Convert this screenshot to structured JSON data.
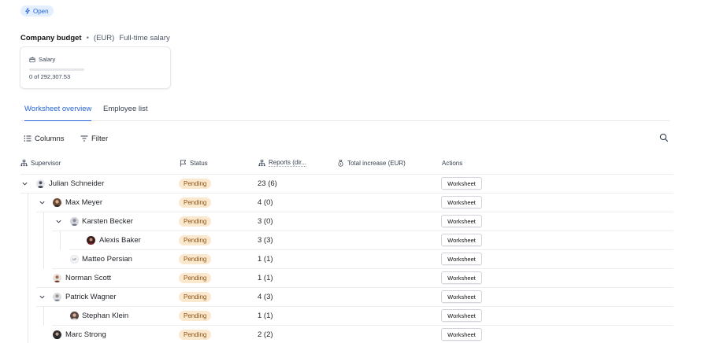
{
  "status_badge": {
    "label": "Open",
    "icon": "lightning-icon"
  },
  "budget": {
    "title": "Company budget",
    "separator": "•",
    "currency": "(EUR)",
    "type": "Full-time salary"
  },
  "salary_card": {
    "label": "Salary",
    "icon": "wallet-icon",
    "amount": "0 of 292,307.53",
    "progress": 0
  },
  "tabs": [
    {
      "label": "Worksheet overview",
      "active": true
    },
    {
      "label": "Employee list",
      "active": false
    }
  ],
  "toolbar": {
    "columns_label": "Columns",
    "filter_label": "Filter",
    "search_icon": "search-icon"
  },
  "columns": [
    {
      "label": "Supervisor",
      "icon": "hierarchy-icon"
    },
    {
      "label": "Status",
      "icon": "flag-icon"
    },
    {
      "label": "Reports (dir...",
      "icon": "hierarchy-icon"
    },
    {
      "label": "Total increase (EUR)",
      "icon": "money-bag-icon"
    },
    {
      "label": "Actions"
    }
  ],
  "rows": [
    {
      "name": "Julian Schneider",
      "status": "Pending",
      "reports": "23 (6)",
      "action": "Worksheet",
      "expanded": true
    },
    {
      "name": "Max Meyer",
      "status": "Pending",
      "reports": "4 (0)",
      "action": "Worksheet",
      "expanded": true
    },
    {
      "name": "Karsten Becker",
      "status": "Pending",
      "reports": "3 (0)",
      "action": "Worksheet",
      "expanded": true
    },
    {
      "name": "Alexis Baker",
      "status": "Pending",
      "reports": "3 (3)",
      "action": "Worksheet"
    },
    {
      "name": "Matteo Persian",
      "status": "Pending",
      "reports": "1 (1)",
      "action": "Worksheet"
    },
    {
      "name": "Norman Scott",
      "status": "Pending",
      "reports": "1 (1)",
      "action": "Worksheet"
    },
    {
      "name": "Patrick Wagner",
      "status": "Pending",
      "reports": "4 (3)",
      "action": "Worksheet",
      "expanded": true
    },
    {
      "name": "Stephan Klein",
      "status": "Pending",
      "reports": "1 (1)",
      "action": "Worksheet"
    },
    {
      "name": "Marc Strong",
      "status": "Pending",
      "reports": "2 (2)",
      "action": "Worksheet"
    }
  ],
  "colors": {
    "accent": "#2563d9",
    "pending_bg": "#fbe9cf",
    "pending_text": "#8a5413",
    "open_bg": "#e3efff"
  }
}
